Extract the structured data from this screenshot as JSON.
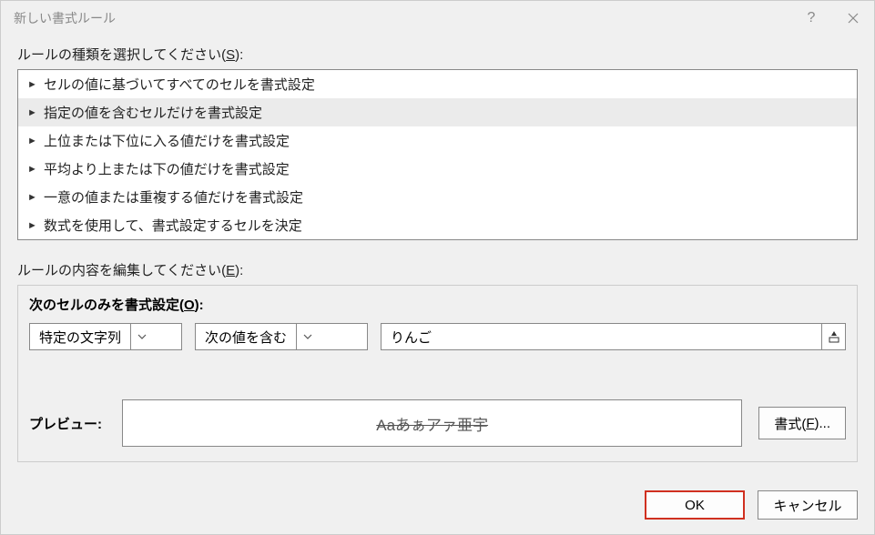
{
  "titlebar": {
    "title": "新しい書式ルール"
  },
  "labels": {
    "select_rule_type_prefix": "ルールの種類を選択してください(",
    "select_rule_type_key": "S",
    "select_rule_type_suffix": "):",
    "edit_rule_desc_prefix": "ルールの内容を編集してください(",
    "edit_rule_desc_key": "E",
    "edit_rule_desc_suffix": "):",
    "inner_title_prefix": "次のセルのみを書式設定(",
    "inner_title_key": "O",
    "inner_title_suffix": "):",
    "preview": "プレビュー:",
    "format_btn_prefix": "書式(",
    "format_btn_key": "F",
    "format_btn_suffix": ")..."
  },
  "rule_types": [
    {
      "label": "セルの値に基づいてすべてのセルを書式設定",
      "selected": false
    },
    {
      "label": "指定の値を含むセルだけを書式設定",
      "selected": true
    },
    {
      "label": "上位または下位に入る値だけを書式設定",
      "selected": false
    },
    {
      "label": "平均より上または下の値だけを書式設定",
      "selected": false
    },
    {
      "label": "一意の値または重複する値だけを書式設定",
      "selected": false
    },
    {
      "label": "数式を使用して、書式設定するセルを決定",
      "selected": false
    }
  ],
  "controls": {
    "combo1": "特定の文字列",
    "combo2": "次の値を含む",
    "value": "りんご"
  },
  "preview": {
    "sample": "Aaあぁアァ亜宇"
  },
  "footer": {
    "ok": "OK",
    "cancel": "キャンセル"
  }
}
